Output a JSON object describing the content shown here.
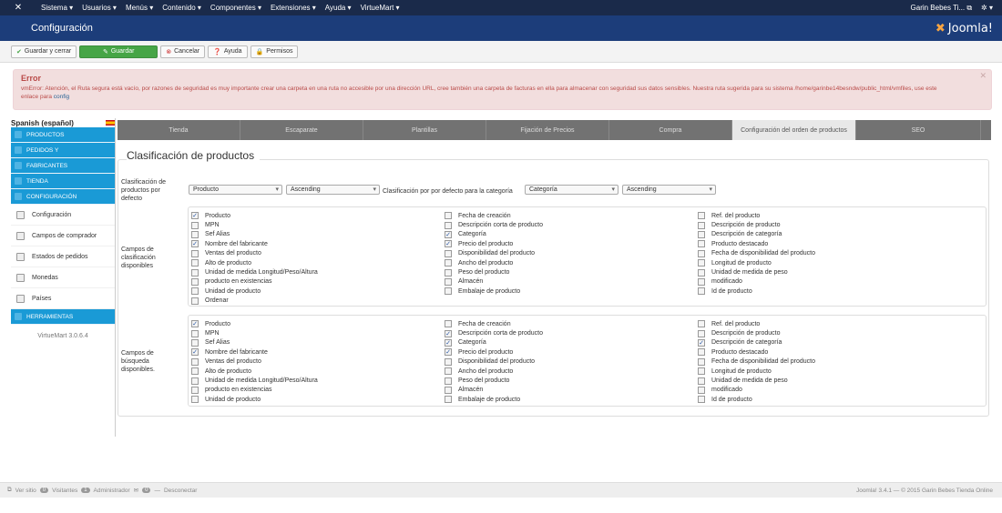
{
  "topnav": {
    "menus": [
      "Sistema ▾",
      "Usuarios ▾",
      "Menús ▾",
      "Contenido ▾",
      "Componentes ▾",
      "Extensiones ▾",
      "Ayuda ▾",
      "VirtueMart ▾"
    ],
    "user": "Garin Bebes Ti... ⧉",
    "settings": "✲ ▾"
  },
  "header": {
    "title": "Configuración",
    "logo_text": "Joomla!"
  },
  "toolbar": {
    "save_close": "Guardar y cerrar",
    "save": "Guardar",
    "cancel": "Cancelar",
    "help": "Ayuda",
    "permissions": "Permisos"
  },
  "error": {
    "title": "Error",
    "message": "vmError: Atención, el Ruta segura está vacío, por razones de seguridad es muy importante crear una carpeta en una ruta no accesible por una dirección URL, cree también una carpeta de facturas en ella para almacenar con seguridad sus datos sensibles. Nuestra ruta sugerida para su sistema /home/garinbe14besndw/public_html/vmfiles, use este enlace para",
    "link": "config"
  },
  "sidebar": {
    "language": "Spanish (español)",
    "sections": [
      {
        "label": "PRODUCTOS"
      },
      {
        "label": "PEDIDOS Y"
      },
      {
        "label": "FABRICANTES"
      },
      {
        "label": "TIENDA"
      },
      {
        "label": "CONFIGURACIÓN"
      }
    ],
    "items": [
      "Configuración",
      "Campos de comprador",
      "Estados de pedidos",
      "Monedas",
      "Países"
    ],
    "tools": "HERRAMIENTAS",
    "version": "VirtueMart 3.0.6.4"
  },
  "tabs": [
    "Tienda",
    "Escaparate",
    "Plantillas",
    "Fijación de Precios",
    "Compra",
    "Configuración del orden de productos",
    "SEO"
  ],
  "panel": {
    "title": "Clasificación de productos",
    "default_label": "Clasificación de productos por defecto",
    "sel_product": "Producto",
    "sel_order1": "Ascending",
    "category_label": "Clasificación por por defecto para la categoría",
    "sel_category": "Categoría",
    "sel_order2": "Ascending",
    "available_label": "Campos de clasificación disponibles",
    "search_label": "Campos de búsqueda disponibles."
  },
  "sort_fields": {
    "col1": [
      {
        "label": "Producto",
        "checked": true
      },
      {
        "label": "MPN",
        "checked": false
      },
      {
        "label": "Sef Alias",
        "checked": false
      },
      {
        "label": "Nombre del fabricante",
        "checked": true
      },
      {
        "label": "Ventas del producto",
        "checked": false
      },
      {
        "label": "Alto de producto",
        "checked": false
      },
      {
        "label": "Unidad de medida Longitud/Peso/Altura",
        "checked": false
      },
      {
        "label": "producto en existencias",
        "checked": false
      },
      {
        "label": "Unidad de producto",
        "checked": false
      },
      {
        "label": "Ordenar",
        "checked": false
      }
    ],
    "col2": [
      {
        "label": "Fecha de creación",
        "checked": false
      },
      {
        "label": "Descripción corta de producto",
        "checked": false
      },
      {
        "label": "Categoría",
        "checked": true
      },
      {
        "label": "Precio del producto",
        "checked": true
      },
      {
        "label": "Disponibilidad del producto",
        "checked": false
      },
      {
        "label": "Ancho del producto",
        "checked": false
      },
      {
        "label": "Peso del producto",
        "checked": false
      },
      {
        "label": "Almacén",
        "checked": false
      },
      {
        "label": "Embalaje de producto",
        "checked": false
      }
    ],
    "col3": [
      {
        "label": "Ref. del producto",
        "checked": false
      },
      {
        "label": "Descripción de producto",
        "checked": false
      },
      {
        "label": "Descripción de categoría",
        "checked": false
      },
      {
        "label": "Producto destacado",
        "checked": false
      },
      {
        "label": "Fecha de disponibilidad del producto",
        "checked": false
      },
      {
        "label": "Longitud de producto",
        "checked": false
      },
      {
        "label": "Unidad de medida de peso",
        "checked": false
      },
      {
        "label": "modificado",
        "checked": false
      },
      {
        "label": "Id de producto",
        "checked": false
      }
    ]
  },
  "search_fields": {
    "col1": [
      {
        "label": "Producto",
        "checked": true
      },
      {
        "label": "MPN",
        "checked": false
      },
      {
        "label": "Sef Alias",
        "checked": false
      },
      {
        "label": "Nombre del fabricante",
        "checked": true
      },
      {
        "label": "Ventas del producto",
        "checked": false
      },
      {
        "label": "Alto de producto",
        "checked": false
      },
      {
        "label": "Unidad de medida Longitud/Peso/Altura",
        "checked": false
      },
      {
        "label": "producto en existencias",
        "checked": false
      },
      {
        "label": "Unidad de producto",
        "checked": false
      }
    ],
    "col2": [
      {
        "label": "Fecha de creación",
        "checked": false
      },
      {
        "label": "Descripción corta de producto",
        "checked": true
      },
      {
        "label": "Categoría",
        "checked": true
      },
      {
        "label": "Precio del producto",
        "checked": true
      },
      {
        "label": "Disponibilidad del producto",
        "checked": false
      },
      {
        "label": "Ancho del producto",
        "checked": false
      },
      {
        "label": "Peso del producto",
        "checked": false
      },
      {
        "label": "Almacén",
        "checked": false
      },
      {
        "label": "Embalaje de producto",
        "checked": false
      }
    ],
    "col3": [
      {
        "label": "Ref. del producto",
        "checked": false
      },
      {
        "label": "Descripción de producto",
        "checked": false
      },
      {
        "label": "Descripción de categoría",
        "checked": true
      },
      {
        "label": "Producto destacado",
        "checked": false
      },
      {
        "label": "Fecha de disponibilidad del producto",
        "checked": false
      },
      {
        "label": "Longitud de producto",
        "checked": false
      },
      {
        "label": "Unidad de medida de peso",
        "checked": false
      },
      {
        "label": "modificado",
        "checked": false
      },
      {
        "label": "Id de producto",
        "checked": false
      }
    ]
  },
  "footer": {
    "view_site": "Ver sitio",
    "visitors_count": "0",
    "visitors": "Visitantes",
    "admin_count": "1",
    "admin": "Administrador",
    "msg_count": "0",
    "logout": "Desconectar",
    "right": "Joomla! 3.4.1 — © 2015 Garin Bebes Tienda Online"
  }
}
